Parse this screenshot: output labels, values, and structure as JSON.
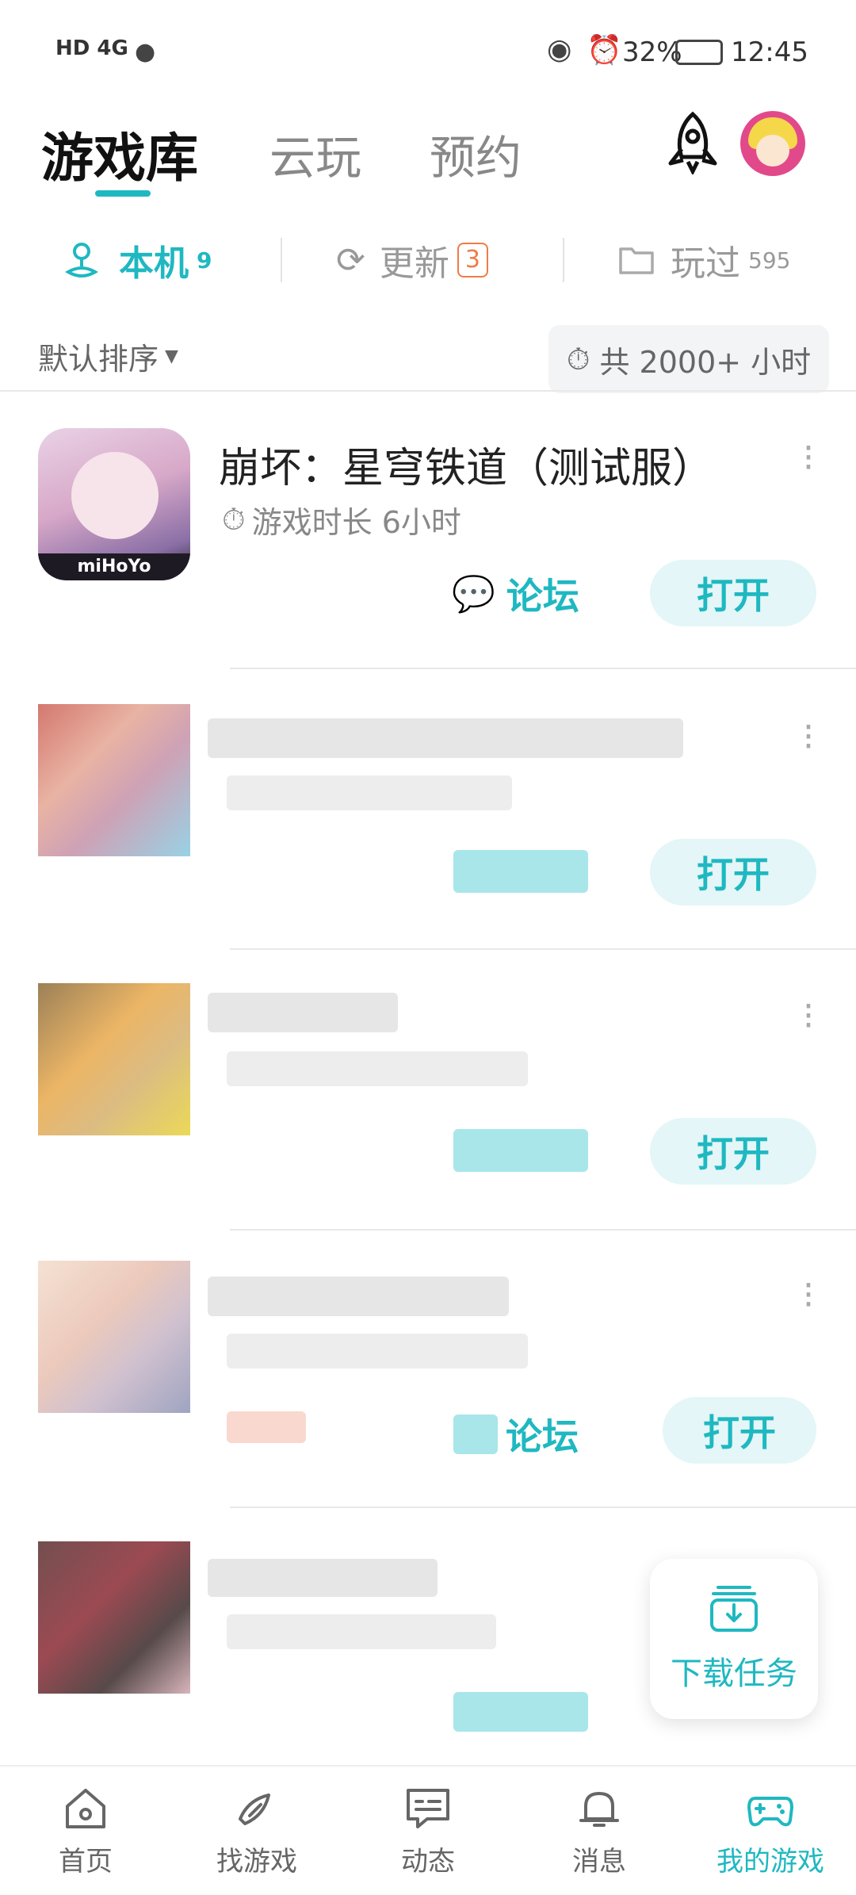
{
  "status_bar": {
    "network": "HD 4G",
    "battery": "32%",
    "time": "12:45"
  },
  "header": {
    "tabs": [
      {
        "label": "游戏库"
      },
      {
        "label": "云玩"
      },
      {
        "label": "预约"
      }
    ]
  },
  "sub_tabs": {
    "local": {
      "label": "本机",
      "count": "9"
    },
    "update": {
      "label": "更新",
      "count": "3"
    },
    "played": {
      "label": "玩过",
      "count": "595"
    }
  },
  "toolbar": {
    "sort_label": "默认排序",
    "total_label": "共 2000+ 小时"
  },
  "games": [
    {
      "title": "崩坏：星穹铁道（测试服）",
      "playtime_label": "游戏时长 6小时",
      "icon_text": "miHoYo",
      "forum_label": "论坛",
      "open_label": "打开"
    },
    {
      "open_label": "打开"
    },
    {
      "open_label": "打开"
    },
    {
      "forum_label": "论坛",
      "open_label": "打开"
    }
  ],
  "download_task": {
    "label": "下载任务"
  },
  "bottom_nav": [
    {
      "label": "首页"
    },
    {
      "label": "找游戏"
    },
    {
      "label": "动态"
    },
    {
      "label": "消息"
    },
    {
      "label": "我的游戏"
    }
  ],
  "colors": {
    "accent": "#1fb8c1",
    "badge": "#f07b47"
  }
}
